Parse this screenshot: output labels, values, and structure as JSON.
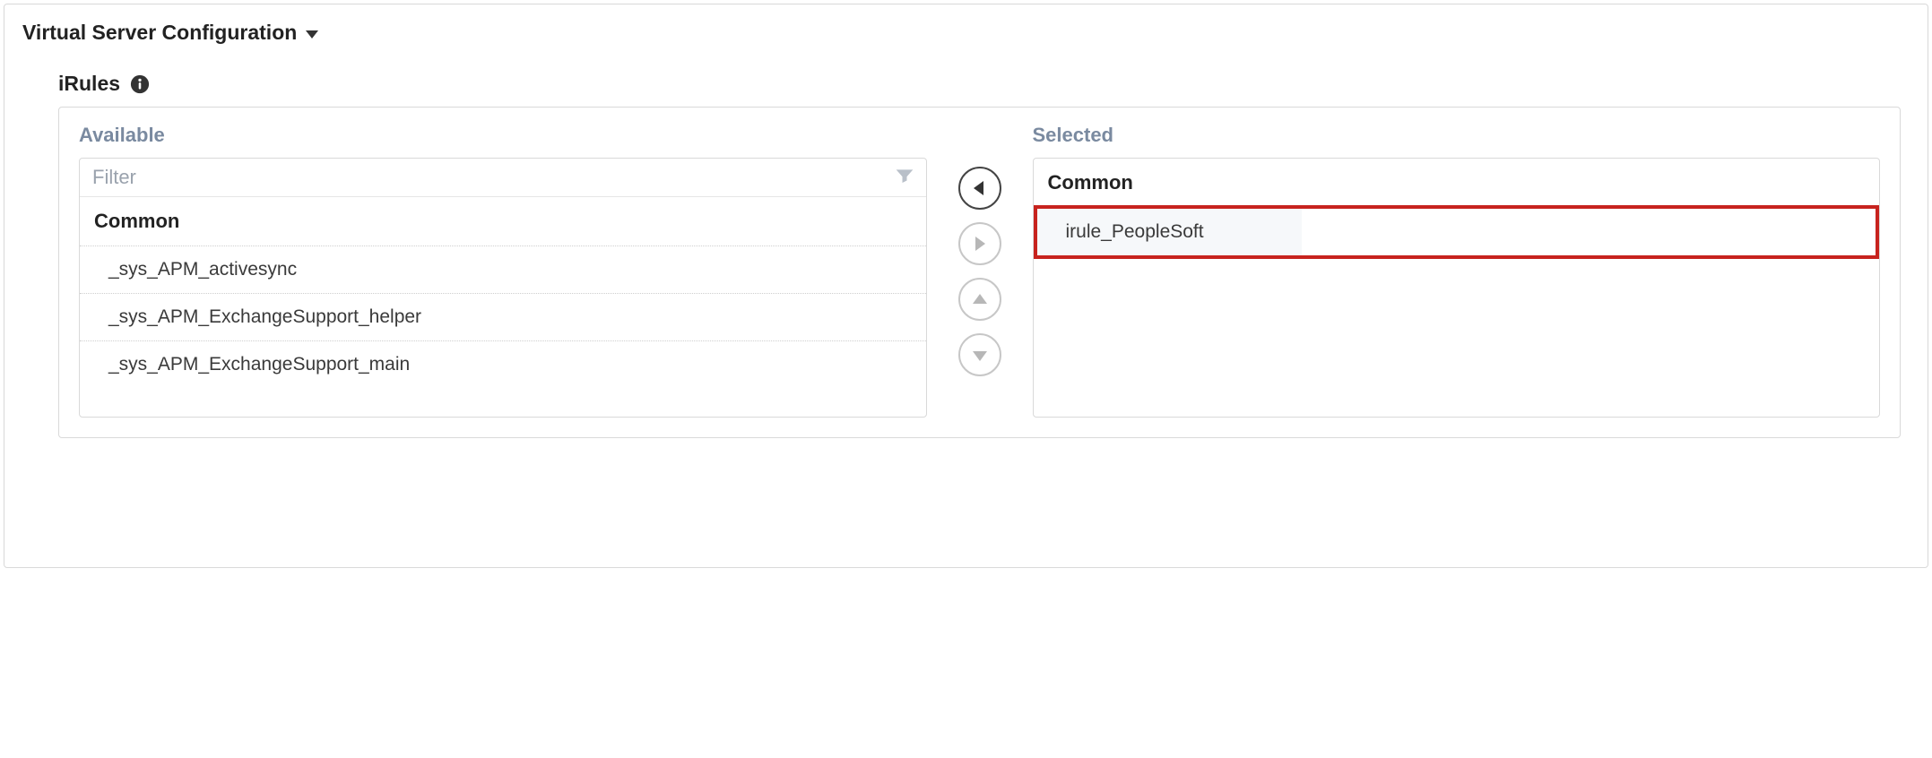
{
  "section_title": "Virtual Server Configuration",
  "sub_label": "iRules",
  "available": {
    "title": "Available",
    "filter_placeholder": "Filter",
    "group": "Common",
    "items": [
      "_sys_APM_activesync",
      "_sys_APM_ExchangeSupport_helper",
      "_sys_APM_ExchangeSupport_main"
    ]
  },
  "selected": {
    "title": "Selected",
    "group": "Common",
    "items": [
      "irule_PeopleSoft"
    ]
  }
}
